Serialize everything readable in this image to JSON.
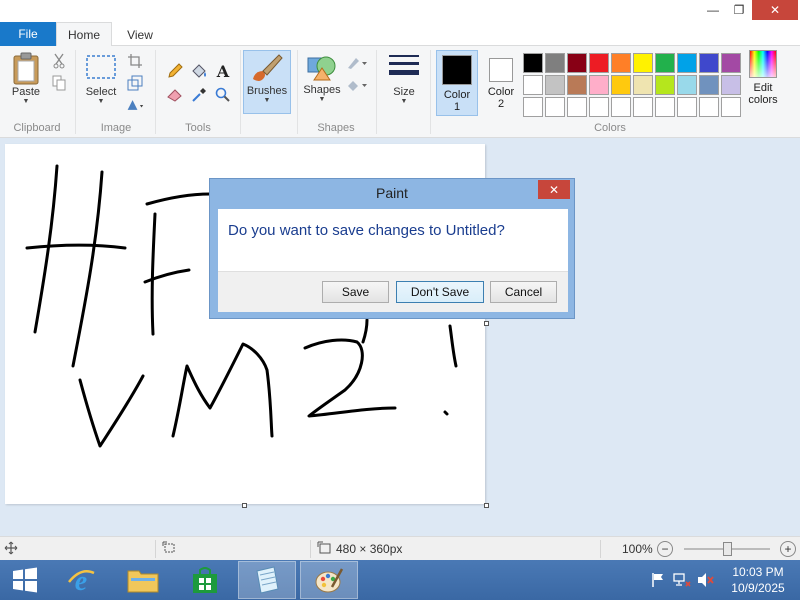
{
  "window": {
    "minimize_glyph": "—",
    "restore_glyph": "❐",
    "close_glyph": "✕"
  },
  "tabs": {
    "file": "File",
    "home": "Home",
    "view": "View"
  },
  "ribbon": {
    "clipboard": {
      "paste_label": "Paste",
      "group_label": "Clipboard"
    },
    "image": {
      "select_label": "Select",
      "group_label": "Image"
    },
    "tools": {
      "group_label": "Tools"
    },
    "brushes": {
      "label": "Brushes"
    },
    "shapes": {
      "label": "Shapes",
      "group_label": "Shapes"
    },
    "size": {
      "label": "Size"
    },
    "colors": {
      "color1_label_a": "Color",
      "color1_label_b": "1",
      "color1_value": "#000000",
      "color2_label_a": "Color",
      "color2_label_b": "2",
      "color2_value": "#ffffff",
      "edit_label_a": "Edit",
      "edit_label_b": "colors",
      "group_label": "Colors",
      "palette": [
        "#000000",
        "#7f7f7f",
        "#880015",
        "#ed1c24",
        "#ff7f27",
        "#fff200",
        "#22b14c",
        "#00a2e8",
        "#3f48cc",
        "#a349a4",
        "#ffffff",
        "#c3c3c3",
        "#b97a57",
        "#ffaec9",
        "#ffc90e",
        "#efe4b0",
        "#b5e61d",
        "#99d9ea",
        "#7092be",
        "#c8bfe7",
        "#ffffff",
        "#ffffff",
        "#ffffff",
        "#ffffff",
        "#ffffff",
        "#ffffff",
        "#ffffff",
        "#ffffff",
        "#ffffff",
        "#ffffff"
      ]
    }
  },
  "dialog": {
    "title": "Paint",
    "close_glyph": "✕",
    "message": "Do you want to save changes to Untitled?",
    "save_label": "Save",
    "dont_save_label": "Don't Save",
    "cancel_label": "Cancel"
  },
  "statusbar": {
    "dimensions": "480 × 360px",
    "zoom": "100%",
    "zoom_out_glyph": "−",
    "zoom_in_glyph": "+"
  },
  "taskbar": {
    "time": "10:03 PM",
    "date": "10/9/2025"
  }
}
